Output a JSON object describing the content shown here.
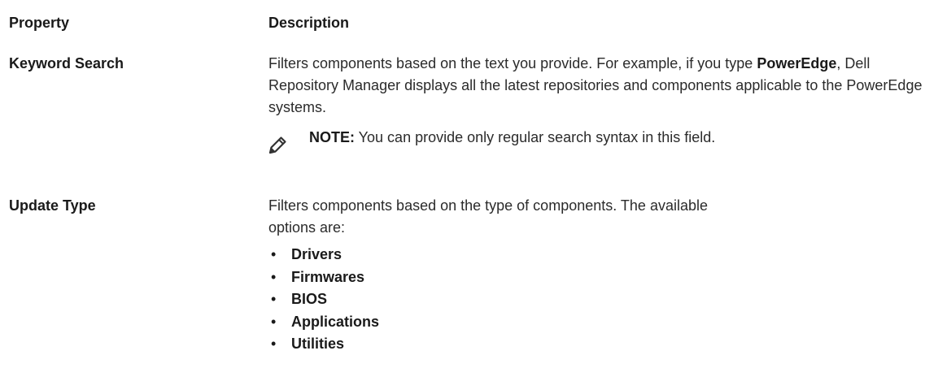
{
  "table": {
    "header": {
      "property": "Property",
      "description": "Description"
    },
    "rows": [
      {
        "property": "Keyword Search",
        "description_before": "Filters components based on the text you provide. For example, if you type ",
        "description_strong": "PowerEdge",
        "description_after": ", Dell Repository Manager displays all the latest repositories and components applicable to the PowerEdge systems.",
        "note_label": "NOTE:",
        "note_text": " You can provide only regular search syntax in this field.",
        "note_icon": "pencil-note-icon"
      },
      {
        "property": "Update Type",
        "description": "Filters components based on the type of components. The available options are:",
        "options": [
          "Drivers",
          "Firmwares",
          "BIOS",
          "Applications",
          "Utilities"
        ],
        "bullet": "•"
      }
    ]
  }
}
